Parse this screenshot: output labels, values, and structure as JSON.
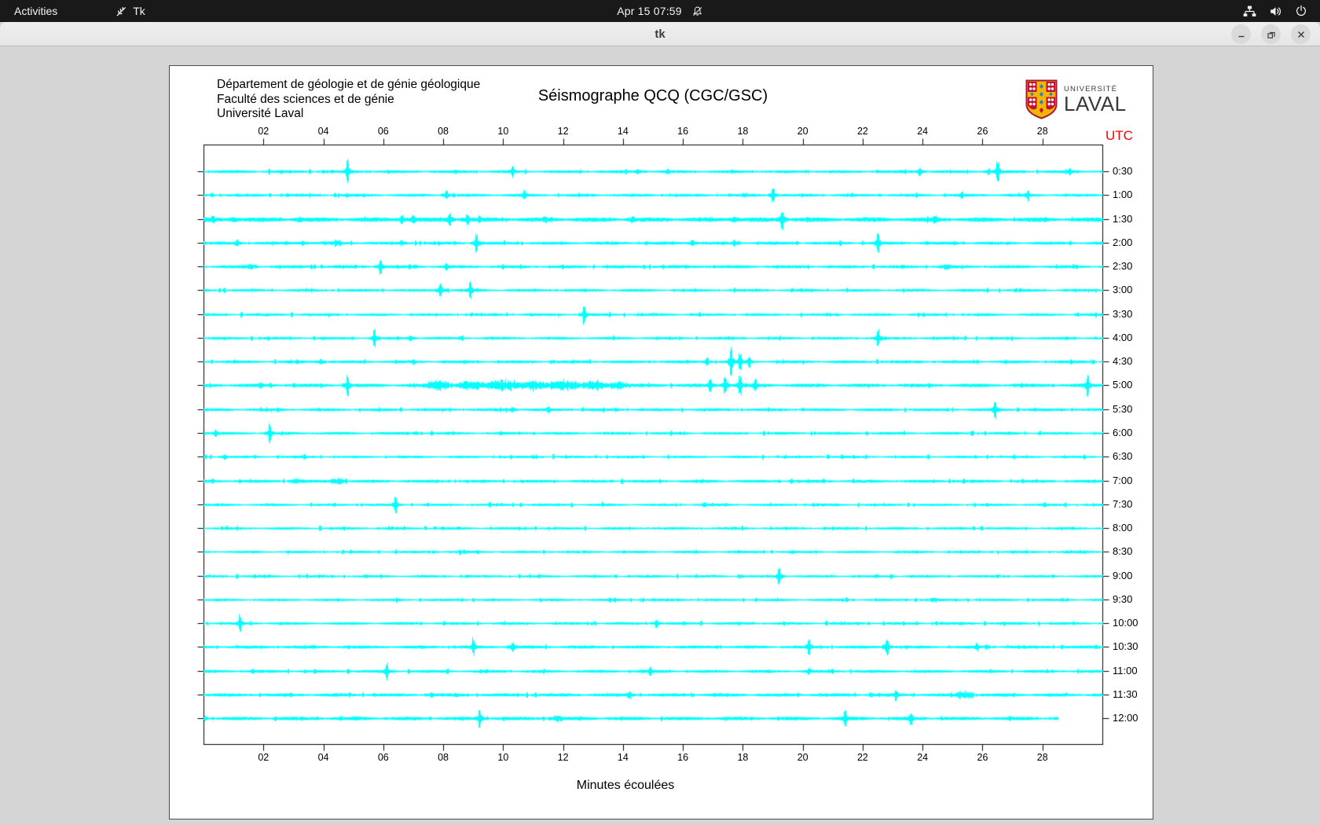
{
  "topbar": {
    "activities": "Activities",
    "app_name": "Tk",
    "clock": "Apr 15 07:59",
    "icons": [
      "tk-feather-icon",
      "notifications-disabled-icon",
      "network-tree-icon",
      "volume-icon",
      "power-icon"
    ]
  },
  "titlebar": {
    "title": "tk",
    "buttons": [
      "minimize",
      "maximize",
      "close"
    ]
  },
  "canvas_header": {
    "line1": "Département de géologie et de génie géologique",
    "line2": "Faculté des sciences et de génie",
    "line3": "Université Laval"
  },
  "logo": {
    "line1": "UNIVERSITÉ",
    "line2": "LAVAL"
  },
  "chart_data": {
    "type": "line",
    "subtype": "seismogram-helicorder",
    "title": "Séismographe QCQ (CGC/GSC)",
    "xlabel": "Minutes écoulées",
    "utc_label": "UTC",
    "trace_color": "#00ffff",
    "axis_color": "#000000",
    "utc_color": "#f50000",
    "x_range": [
      0,
      30
    ],
    "x_tick_minutes": [
      2,
      4,
      6,
      8,
      10,
      12,
      14,
      16,
      18,
      20,
      22,
      24,
      26,
      28
    ],
    "x_tick_labels": [
      "02",
      "04",
      "06",
      "08",
      "10",
      "12",
      "14",
      "16",
      "18",
      "20",
      "22",
      "24",
      "26",
      "28"
    ],
    "grid": false,
    "legend": "none",
    "rows": [
      {
        "label": "0:30",
        "base": 1.6,
        "end": 30,
        "events": [
          [
            4.8,
            16,
            0
          ],
          [
            10.3,
            8,
            0
          ],
          [
            14.5,
            4,
            0
          ],
          [
            23.9,
            6,
            0
          ],
          [
            26.2,
            5,
            0
          ],
          [
            26.5,
            15,
            0
          ],
          [
            28.9,
            5,
            0
          ]
        ]
      },
      {
        "label": "1:00",
        "base": 1.6,
        "end": 30,
        "events": [
          [
            8.1,
            6,
            0
          ],
          [
            10.7,
            7,
            0
          ],
          [
            19.0,
            9,
            0
          ],
          [
            25.3,
            5,
            0
          ],
          [
            27.5,
            8,
            0
          ]
        ]
      },
      {
        "label": "1:30",
        "base": 2.4,
        "end": 30,
        "events": [
          [
            0.3,
            5,
            0
          ],
          [
            1.0,
            4,
            0
          ],
          [
            3.2,
            4,
            0
          ],
          [
            6.6,
            6,
            0
          ],
          [
            7.0,
            7,
            0
          ],
          [
            8.2,
            9,
            0
          ],
          [
            8.8,
            7,
            0
          ],
          [
            9.2,
            6,
            0
          ],
          [
            11.4,
            5,
            0
          ],
          [
            14.3,
            5,
            0
          ],
          [
            17.7,
            4,
            0
          ],
          [
            19.3,
            14,
            0
          ],
          [
            24.4,
            6,
            0
          ]
        ]
      },
      {
        "label": "2:00",
        "base": 1.7,
        "end": 30,
        "events": [
          [
            1.1,
            5,
            0
          ],
          [
            3.3,
            4,
            0
          ],
          [
            4.4,
            6,
            0.25
          ],
          [
            6.6,
            4,
            0
          ],
          [
            9.1,
            15,
            0
          ],
          [
            16.3,
            4,
            0
          ],
          [
            17.7,
            5,
            0
          ],
          [
            22.5,
            13,
            0
          ]
        ]
      },
      {
        "label": "2:30",
        "base": 1.7,
        "end": 30,
        "events": [
          [
            1.5,
            5,
            0.3
          ],
          [
            5.9,
            11,
            0
          ],
          [
            8.1,
            5,
            0
          ],
          [
            24.8,
            5,
            0.3
          ]
        ]
      },
      {
        "label": "3:00",
        "base": 1.5,
        "end": 30,
        "events": [
          [
            7.9,
            12,
            0
          ],
          [
            8.9,
            13,
            0
          ]
        ]
      },
      {
        "label": "3:30",
        "base": 1.5,
        "end": 30,
        "events": [
          [
            12.7,
            13,
            0
          ]
        ]
      },
      {
        "label": "4:00",
        "base": 1.5,
        "end": 30,
        "events": [
          [
            5.7,
            12,
            0
          ],
          [
            6.9,
            5,
            0
          ],
          [
            22.5,
            12,
            0
          ]
        ]
      },
      {
        "label": "4:30",
        "base": 1.6,
        "end": 30,
        "events": [
          [
            3.9,
            4,
            0
          ],
          [
            7.0,
            4,
            0
          ],
          [
            16.8,
            6,
            0
          ],
          [
            17.6,
            22,
            0
          ],
          [
            17.9,
            12,
            0
          ],
          [
            18.2,
            8,
            0
          ]
        ]
      },
      {
        "label": "5:00",
        "base": 1.9,
        "end": 30,
        "events": [
          [
            1.9,
            4,
            0
          ],
          [
            4.8,
            14,
            0
          ],
          [
            7.8,
            8,
            0.5
          ],
          [
            8.9,
            9,
            0.5
          ],
          [
            10.0,
            10,
            0.6
          ],
          [
            11.0,
            9,
            0.5
          ],
          [
            12.0,
            10,
            0.6
          ],
          [
            13.0,
            9,
            0.5
          ],
          [
            13.8,
            8,
            0.4
          ],
          [
            16.9,
            9,
            0
          ],
          [
            17.4,
            11,
            0
          ],
          [
            17.9,
            13,
            0
          ],
          [
            18.4,
            9,
            0
          ],
          [
            29.5,
            15,
            0
          ]
        ]
      },
      {
        "label": "5:30",
        "base": 1.6,
        "end": 30,
        "events": [
          [
            10.3,
            4,
            0
          ],
          [
            11.5,
            5,
            0
          ],
          [
            26.4,
            13,
            0
          ]
        ]
      },
      {
        "label": "6:00",
        "base": 1.5,
        "end": 30,
        "events": [
          [
            0.4,
            5,
            0
          ],
          [
            2.2,
            13,
            0
          ]
        ]
      },
      {
        "label": "6:30",
        "base": 1.4,
        "end": 30,
        "events": [
          [
            0.7,
            4,
            0
          ]
        ]
      },
      {
        "label": "7:00",
        "base": 1.6,
        "end": 30,
        "events": [
          [
            3.1,
            5,
            0.3
          ],
          [
            4.5,
            6,
            0.3
          ]
        ]
      },
      {
        "label": "7:30",
        "base": 1.4,
        "end": 30,
        "events": [
          [
            6.4,
            12,
            0
          ]
        ]
      },
      {
        "label": "8:00",
        "base": 1.4,
        "end": 30,
        "events": []
      },
      {
        "label": "8:30",
        "base": 1.4,
        "end": 30,
        "events": []
      },
      {
        "label": "9:00",
        "base": 1.4,
        "end": 30,
        "events": [
          [
            19.2,
            12,
            0
          ]
        ]
      },
      {
        "label": "9:30",
        "base": 1.4,
        "end": 30,
        "events": [
          [
            24.3,
            4,
            0.2
          ]
        ]
      },
      {
        "label": "10:00",
        "base": 1.5,
        "end": 30,
        "events": [
          [
            1.2,
            12,
            0
          ],
          [
            15.1,
            6,
            0
          ]
        ]
      },
      {
        "label": "10:30",
        "base": 1.7,
        "end": 30,
        "events": [
          [
            9.0,
            13,
            0
          ],
          [
            10.3,
            7,
            0
          ],
          [
            20.2,
            12,
            0
          ],
          [
            22.8,
            11,
            0
          ],
          [
            25.8,
            6,
            0
          ]
        ]
      },
      {
        "label": "11:00",
        "base": 1.6,
        "end": 30,
        "events": [
          [
            6.1,
            13,
            0
          ],
          [
            14.9,
            6,
            0
          ],
          [
            20.2,
            5,
            0
          ]
        ]
      },
      {
        "label": "11:30",
        "base": 1.8,
        "end": 30,
        "events": [
          [
            7.6,
            4,
            0
          ],
          [
            14.2,
            5,
            0
          ],
          [
            23.1,
            8,
            0
          ],
          [
            25.4,
            8,
            0.3
          ]
        ]
      },
      {
        "label": "12:00",
        "base": 1.9,
        "end": 28.5,
        "events": [
          [
            5.1,
            5,
            0.25
          ],
          [
            9.2,
            12,
            0
          ],
          [
            11.8,
            6,
            0.3
          ],
          [
            21.4,
            11,
            0
          ],
          [
            23.6,
            9,
            0
          ]
        ]
      }
    ]
  }
}
